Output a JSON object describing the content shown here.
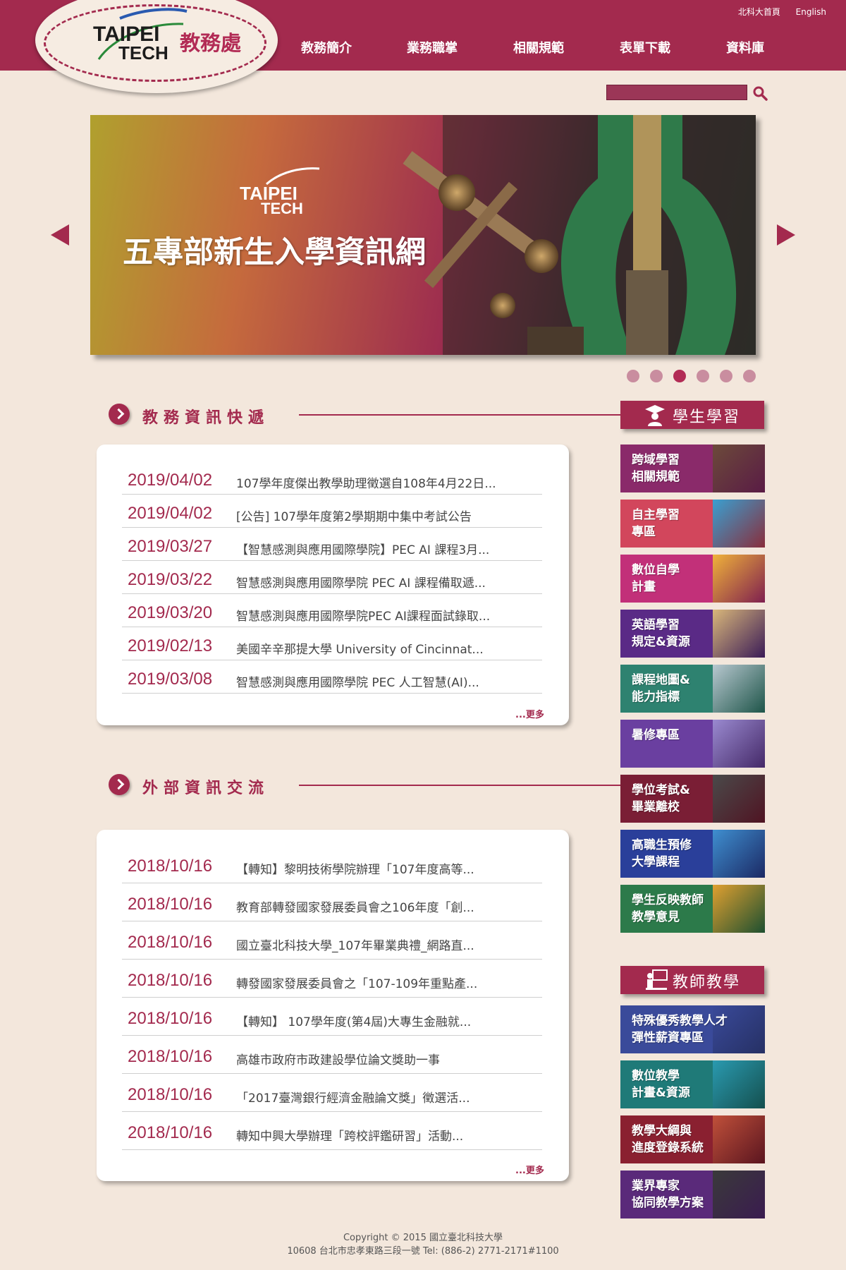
{
  "header": {
    "logo_line1": "TAIPEI",
    "logo_line2": "TECH",
    "dept_name": "教務處",
    "top_links": [
      "北科大首頁",
      "English"
    ],
    "nav": [
      "教務簡介",
      "業務職掌",
      "相關規範",
      "表單下載",
      "資料庫"
    ]
  },
  "search": {
    "placeholder": "",
    "icon": "search-icon"
  },
  "banner": {
    "logo_line1": "TAIPEI",
    "logo_line2": "TECH",
    "title": "五專部新生入學資訊網",
    "slide_count": 6,
    "active_slide": 3
  },
  "section1": {
    "title": "教務資訊快遞",
    "more": "...更多",
    "items": [
      {
        "date": "2019/04/02",
        "text": "107學年度傑出教學助理徵選自108年4月22日..."
      },
      {
        "date": "2019/04/02",
        "text": "[公告] 107學年度第2學期期中集中考試公告"
      },
      {
        "date": "2019/03/27",
        "text": "【智慧感測與應用國際學院】PEC AI 課程3月..."
      },
      {
        "date": "2019/03/22",
        "text": "智慧感測與應用國際學院 PEC AI 課程備取遞..."
      },
      {
        "date": "2019/03/20",
        "text": "智慧感測與應用國際學院PEC AI課程面試錄取..."
      },
      {
        "date": "2019/02/13",
        "text": "美國辛辛那提大學 University of Cincinnat..."
      },
      {
        "date": "2019/03/08",
        "text": "智慧感測與應用國際學院 PEC 人工智慧(AI)..."
      }
    ]
  },
  "section2": {
    "title": "外部資訊交流",
    "more": "...更多",
    "items": [
      {
        "date": "2018/10/16",
        "text": "【轉知】黎明技術學院辦理「107年度高等..."
      },
      {
        "date": "2018/10/16",
        "text": "教育部轉發國家發展委員會之106年度「創..."
      },
      {
        "date": "2018/10/16",
        "text": "國立臺北科技大學_107年畢業典禮_網路直..."
      },
      {
        "date": "2018/10/16",
        "text": "轉發國家發展委員會之「107-109年重點產..."
      },
      {
        "date": "2018/10/16",
        "text": "【轉知】 107學年度(第4屆)大專生金融就..."
      },
      {
        "date": "2018/10/16",
        "text": "高雄市政府市政建設學位論文獎助一事"
      },
      {
        "date": "2018/10/16",
        "text": "「2017臺灣銀行經濟金融論文獎」徵選活..."
      },
      {
        "date": "2018/10/16",
        "text": "轉知中興大學辦理「跨校評鑑研習」活動..."
      }
    ]
  },
  "sidebar": {
    "student_title": "學生學習",
    "student_items": [
      {
        "label": "跨域學習\n相關規範",
        "bg": "#8a2a6a",
        "pic": "#6c4a3a"
      },
      {
        "label": "自主學習\n專區",
        "bg": "#d2465c",
        "pic": "#3a9fd0"
      },
      {
        "label": "數位自學\n計畫",
        "bg": "#c23079",
        "pic": "#f0b23a"
      },
      {
        "label": "英語學習\n規定&資源",
        "bg": "#5a2a86",
        "pic": "#d9b77a"
      },
      {
        "label": "課程地圖&\n能力指標",
        "bg": "#2e8270",
        "pic": "#b8c8d0"
      },
      {
        "label": "暑修專區",
        "bg": "#6a3fa0",
        "pic": "#9a8ad0"
      },
      {
        "label": "學位考試&\n畢業離校",
        "bg": "#7a1e35",
        "pic": "#4a4a4a"
      },
      {
        "label": "高職生預修\n大學課程",
        "bg": "#2a3f9a",
        "pic": "#3f8fd0"
      },
      {
        "label": "學生反映教師\n教學意見",
        "bg": "#2c7a4a",
        "pic": "#e0a030"
      }
    ],
    "teacher_title": "教師教學",
    "teacher_items": [
      {
        "label": "特殊優秀教學人才\n彈性薪資專區",
        "bg": "#3a4a9a",
        "pic": "#3a4a9a"
      },
      {
        "label": "數位教學\n計畫&資源",
        "bg": "#1f7a78",
        "pic": "#2a9ab0"
      },
      {
        "label": "教學大綱與\n進度登錄系統",
        "bg": "#8a2030",
        "pic": "#c0503a"
      },
      {
        "label": "業界專家\n協同教學方案",
        "bg": "#5a2a7a",
        "pic": "#3a3a3a"
      }
    ]
  },
  "footer": {
    "line1": "Copyright © 2015 國立臺北科技大學",
    "line2": "10608 台北市忠孝東路三段一號    Tel: (886-2) 2771-2171#1100"
  },
  "colors": {
    "brand": "#a32a4e",
    "background": "#f3e7dc"
  }
}
